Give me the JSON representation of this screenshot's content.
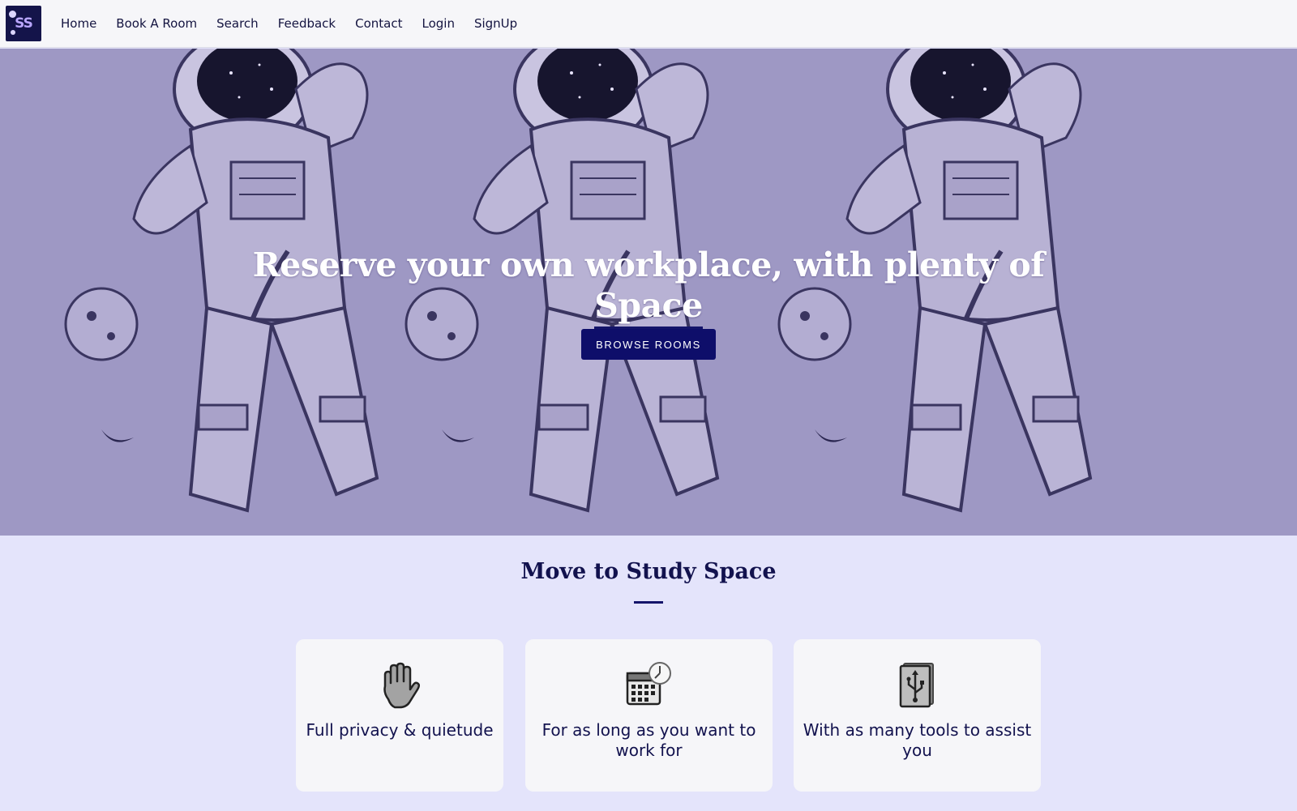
{
  "navbar": {
    "logo_text": "SS",
    "items": [
      {
        "label": "Home"
      },
      {
        "label": "Book A Room"
      },
      {
        "label": "Search"
      },
      {
        "label": "Feedback"
      },
      {
        "label": "Contact"
      },
      {
        "label": "Login"
      },
      {
        "label": "SignUp"
      }
    ]
  },
  "hero": {
    "title_line1": "Reserve your own workplace, with plenty of",
    "title_highlight": "Space",
    "button_label": "BROWSE ROOMS"
  },
  "features": {
    "title": "Move to Study Space",
    "cards": [
      {
        "icon": "raised-hand-icon",
        "text": "Full privacy & quietude"
      },
      {
        "icon": "calendar-clock-icon",
        "text": "For as long as you want to work for"
      },
      {
        "icon": "usb-device-icon",
        "text": "With as many tools to assist you"
      }
    ]
  },
  "colors": {
    "accent": "#0e0e6a",
    "hero_tint": "#9e98c4",
    "page_background": "#e4e4fb",
    "card_background": "#f6f6f9"
  }
}
